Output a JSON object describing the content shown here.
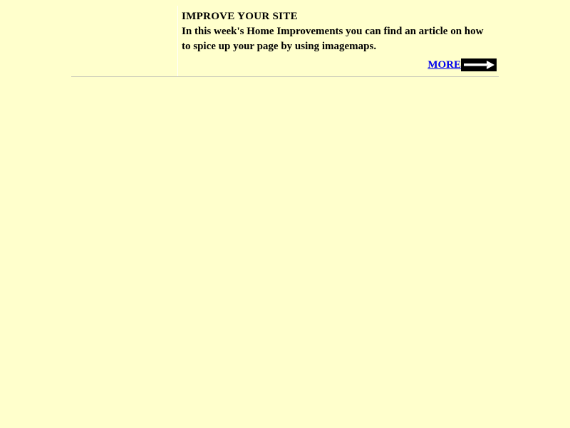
{
  "promo": {
    "heading": "IMPROVE YOUR SITE",
    "body": "In this week's Home Improvements you can find an article on how to spice up your page by using imagemaps.",
    "more_label": "MORE",
    "arrow_icon": "arrow-right-icon"
  },
  "colors": {
    "background": "#ffffcc",
    "link": "#0000ee",
    "arrow_bg": "#000000"
  }
}
